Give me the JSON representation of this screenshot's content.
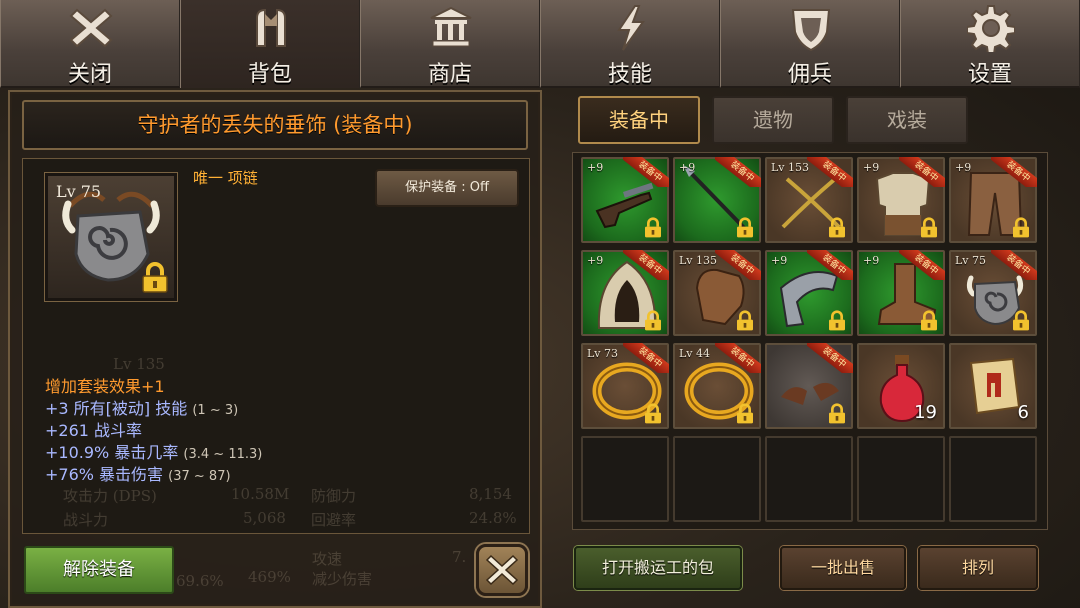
{
  "nav": {
    "tabs": [
      {
        "label": "关闭",
        "icon": "close-x-icon"
      },
      {
        "label": "背包",
        "icon": "backpack-icon"
      },
      {
        "label": "商店",
        "icon": "shop-building-icon"
      },
      {
        "label": "技能",
        "icon": "lightning-icon"
      },
      {
        "label": "佣兵",
        "icon": "shield-icon"
      },
      {
        "label": "设置",
        "icon": "gear-icon"
      }
    ],
    "active": "背包"
  },
  "item_detail": {
    "title": "守护者的丢失的垂饰 (装备中)",
    "level": "Lv 75",
    "type_label": "唯一 项链",
    "protect_button": "保护装备 : Off",
    "stats": {
      "set_bonus": "增加套装效果+1",
      "line1_main": "+3 所有[被动] 技能",
      "line1_range": "(1 ~ 3)",
      "line2_main": "+261 战斗率",
      "line3_main": "+10.9% 暴击几率",
      "line3_range": "(3.4 ~ 11.3)",
      "line4_main": "+76% 暴击伤害",
      "line4_range": "(37 ~ 87)"
    },
    "unequip_button": "解除装备",
    "background_stats": {
      "a_label": "攻击力 (DPS)",
      "a_value": "10.58M",
      "b_label": "防御力",
      "b_value": "8,154",
      "c_label": "战斗力",
      "c_value": "5,068",
      "d_label": "回避率",
      "d_value": "24.8%",
      "e_value": "69.6%",
      "f_label": "攻速",
      "f_value": "7.",
      "g_value": "469%",
      "h_label": "减少伤害",
      "lv_ghost": "Lv 135"
    }
  },
  "inventory": {
    "subtabs": [
      "装备中",
      "遗物",
      "戏装"
    ],
    "active_subtab": "装备中",
    "equipped_badge": "装备中",
    "slots": [
      {
        "corner": "+9",
        "item": "flintlock-pistol-icon",
        "bg": "green",
        "equipped": true,
        "locked": true
      },
      {
        "corner": "+9",
        "item": "spear-icon",
        "bg": "green",
        "equipped": true,
        "locked": true
      },
      {
        "corner": "Lv 153",
        "item": "crossed-swords-icon",
        "bg": "brown",
        "equipped": true,
        "locked": true
      },
      {
        "corner": "+9",
        "item": "tunic-armor-icon",
        "bg": "brown",
        "equipped": true,
        "locked": true
      },
      {
        "corner": "+9",
        "item": "pants-armor-icon",
        "bg": "brown",
        "equipped": true,
        "locked": true
      },
      {
        "corner": "+9",
        "item": "hood-icon",
        "bg": "green",
        "equipped": true,
        "locked": true
      },
      {
        "corner": "Lv 135",
        "item": "glove-icon",
        "bg": "brown",
        "equipped": true,
        "locked": true
      },
      {
        "corner": "+9",
        "item": "bracer-icon",
        "bg": "green",
        "equipped": true,
        "locked": true
      },
      {
        "corner": "+9",
        "item": "boots-icon",
        "bg": "green",
        "equipped": true,
        "locked": true
      },
      {
        "corner": "Lv 75",
        "item": "pendant-necklace-icon",
        "bg": "brown",
        "equipped": true,
        "locked": true
      },
      {
        "corner": "Lv 73",
        "item": "gold-ring-icon",
        "bg": "brown",
        "equipped": true,
        "locked": true
      },
      {
        "corner": "Lv 44",
        "item": "gold-ring-icon",
        "bg": "brown",
        "equipped": true,
        "locked": true
      },
      {
        "corner": "",
        "item": "wings-icon",
        "bg": "grey",
        "equipped": true,
        "locked": true
      },
      {
        "corner": "",
        "item": "red-potion-icon",
        "bg": "brown",
        "equipped": false,
        "locked": false,
        "qty": "19"
      },
      {
        "corner": "",
        "item": "scroll-icon",
        "bg": "brown",
        "equipped": false,
        "locked": false,
        "qty": "6"
      }
    ],
    "empty_slots": 5
  },
  "bottom_buttons": {
    "porter_bag": "打开搬运工的包",
    "bulk_sell": "一批出售",
    "sort": "排列"
  },
  "colors": {
    "title_orange": "#ff9a2e",
    "stat_blue": "#a9b8ff",
    "equipped_badge_red": "#c62d16",
    "slot_green": "#2f9a2e"
  }
}
